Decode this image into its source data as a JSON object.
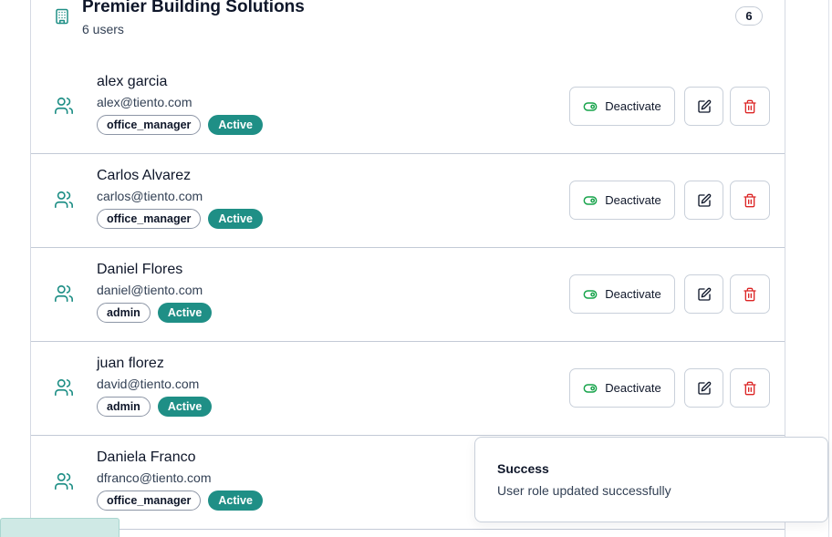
{
  "organization": {
    "name": "Premier Building Solutions",
    "users_label": "6 users",
    "count": "6",
    "icon": "building-icon"
  },
  "actions": {
    "deactivate_label": "Deactivate",
    "edit_icon": "edit-icon",
    "delete_icon": "trash-icon",
    "toggle_icon": "toggle-icon"
  },
  "users": [
    {
      "name": "alex garcia",
      "email": "alex@tiento.com",
      "role": "office_manager",
      "status": "Active"
    },
    {
      "name": "Carlos Alvarez",
      "email": "carlos@tiento.com",
      "role": "office_manager",
      "status": "Active"
    },
    {
      "name": "Daniel Flores",
      "email": "daniel@tiento.com",
      "role": "admin",
      "status": "Active"
    },
    {
      "name": "juan florez",
      "email": "david@tiento.com",
      "role": "admin",
      "status": "Active"
    },
    {
      "name": "Daniela Franco",
      "email": "dfranco@tiento.com",
      "role": "office_manager",
      "status": "Active"
    }
  ],
  "toast": {
    "title": "Success",
    "message": "User role updated successfully"
  },
  "colors": {
    "accent": "#1f8f86",
    "danger": "#dc2626",
    "toggle": "#16a34a"
  }
}
